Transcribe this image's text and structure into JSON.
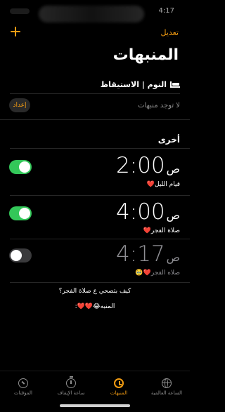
{
  "status": {
    "time": "4:17"
  },
  "header": {
    "edit_label": "تعديل",
    "title": "المنبهات"
  },
  "sleep": {
    "section_label": "النوم | الاستيقاظ",
    "no_alarms_text": "لا توجد منبهات",
    "setup_label": "إعداد"
  },
  "others": {
    "section_label": "أخرى"
  },
  "alarms": [
    {
      "time": "2:00",
      "ampm": "ص",
      "label": "قيام الليل❤️",
      "enabled": true
    },
    {
      "time": "4:00",
      "ampm": "ص",
      "label": "صلاة الفجر❤️",
      "enabled": true
    },
    {
      "time": "4:17",
      "ampm": "ص",
      "label": "صلاه الفجر❤️🥹",
      "enabled": false
    }
  ],
  "notes": {
    "line1": "كيف بتصحي ع صلاة الفجر؟",
    "line2": "المنبه😂❤️❤️:"
  },
  "tabbar": {
    "tabs": [
      {
        "label": "الساعة العالمية",
        "icon": "globe-icon",
        "active": false
      },
      {
        "label": "المنبهات",
        "icon": "alarm-clock-icon",
        "active": true
      },
      {
        "label": "ساعة الإيقاف",
        "icon": "stopwatch-icon",
        "active": false
      },
      {
        "label": "المؤقتات",
        "icon": "timer-icon",
        "active": false
      }
    ]
  },
  "colors": {
    "accent": "#f39c12",
    "toggle_on": "#33c759",
    "toggle_off": "#3a3a3c",
    "background": "#000000"
  }
}
